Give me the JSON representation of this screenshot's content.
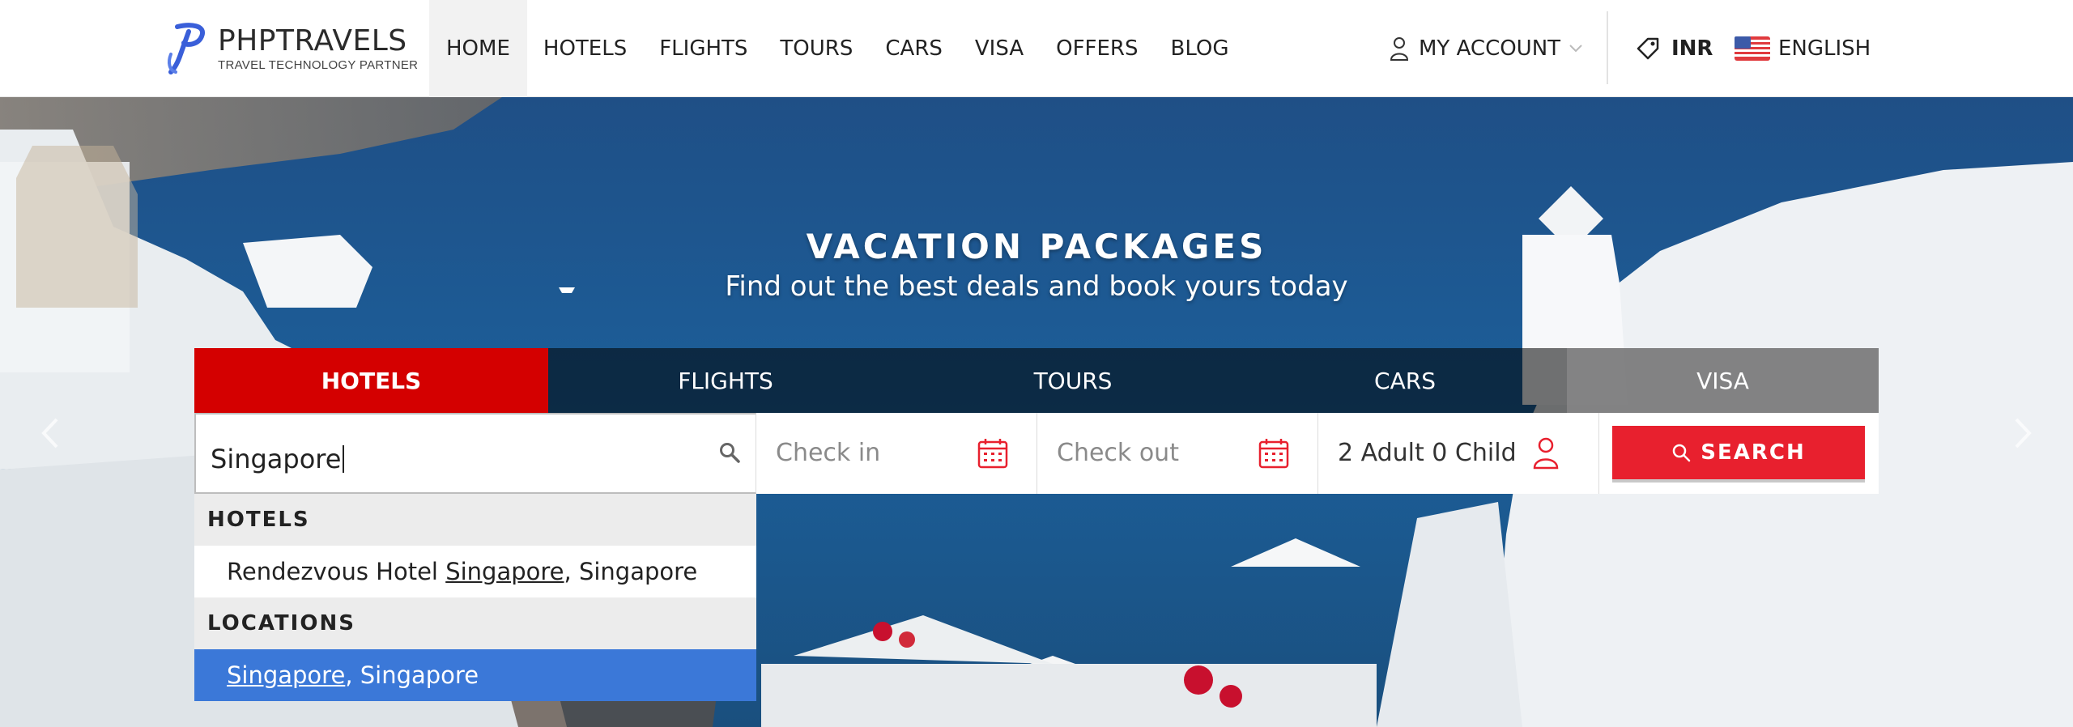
{
  "brand": {
    "name": "PHPTRAVELS",
    "tagline": "TRAVEL TECHNOLOGY PARTNER"
  },
  "nav": {
    "items": [
      "HOME",
      "HOTELS",
      "FLIGHTS",
      "TOURS",
      "CARS",
      "VISA",
      "OFFERS",
      "BLOG"
    ],
    "active": "HOME"
  },
  "account": {
    "label": "MY ACCOUNT",
    "icon": "user-icon"
  },
  "currency": {
    "label": "INR",
    "icon": "ticket-icon"
  },
  "language": {
    "label": "ENGLISH",
    "icon": "us-flag-icon"
  },
  "hero": {
    "title": "VACATION PACKAGES",
    "subtitle": "Find out the best deals and book yours today"
  },
  "search": {
    "tabs": [
      "HOTELS",
      "FLIGHTS",
      "TOURS",
      "CARS",
      "VISA"
    ],
    "active_tab": "HOTELS",
    "destination_value": "Singapore",
    "checkin_placeholder": "Check in",
    "checkout_placeholder": "Check out",
    "guests": "2 Adult 0 Child",
    "button_label": "SEARCH"
  },
  "autocomplete": {
    "groups": [
      {
        "heading": "HOTELS",
        "items": [
          {
            "match": "",
            "pre": "Rendezvous Hotel ",
            "hl": "Singapore",
            "post": ", Singapore",
            "selected": false
          }
        ]
      },
      {
        "heading": "LOCATIONS",
        "items": [
          {
            "pre": "",
            "hl": "Singapore",
            "post": ", Singapore",
            "selected": true
          }
        ]
      }
    ]
  },
  "colors": {
    "accent_red": "#d40000",
    "button_red": "#e8202e",
    "selection_blue": "#3b78d8",
    "brand_blue": "#3a5fd9"
  }
}
